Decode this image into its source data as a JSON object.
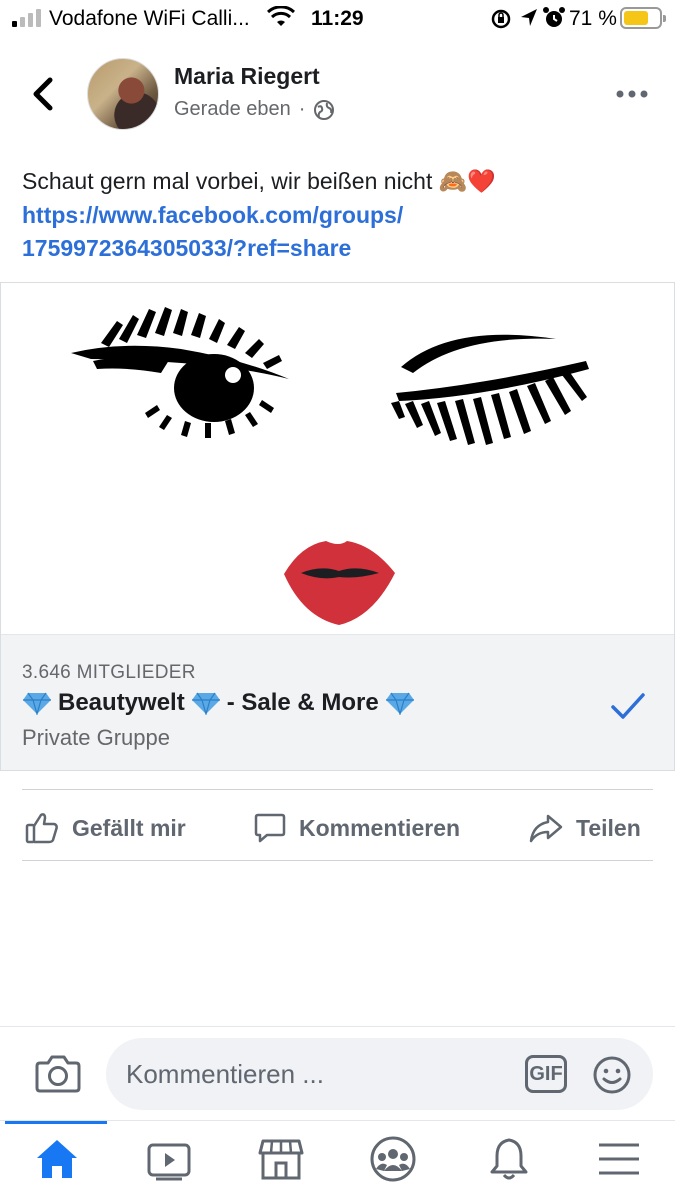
{
  "status_bar": {
    "carrier": "Vodafone WiFi Calli...",
    "time": "11:29",
    "battery_percent": "71 %",
    "battery_level": 0.71,
    "icons": [
      "signal-icon",
      "wifi-icon",
      "orientation-lock-icon",
      "location-arrow-icon",
      "alarm-icon",
      "battery-icon"
    ]
  },
  "header": {
    "author_name": "Maria Riegert",
    "timestamp": "Gerade eben",
    "separator": "·",
    "privacy_icon": "globe-icon"
  },
  "post": {
    "text": "Schaut gern mal vorbei, wir beißen nicht 🙈❤️",
    "link_line1": "https://www.facebook.com/groups/",
    "link_line2": "1759972364305033/?ref=share"
  },
  "shared_group": {
    "members": "3.646 MITGLIEDER",
    "name_part1": "Beautywelt",
    "name_part2": "- Sale & More",
    "privacy": "Private Gruppe",
    "joined_icon": "checkmark-icon"
  },
  "actions": {
    "like": "Gefällt mir",
    "comment": "Kommentieren",
    "share": "Teilen"
  },
  "comment_bar": {
    "placeholder": "Kommentieren ...",
    "gif_label": "GIF"
  },
  "tab_bar": {
    "tabs": [
      "home-icon",
      "watch-icon",
      "marketplace-icon",
      "groups-icon",
      "notifications-icon",
      "menu-icon"
    ],
    "active": "home-icon"
  },
  "colors": {
    "accent": "#1877f2",
    "link": "#2d6fd8",
    "muted": "#65676b",
    "lips": "#d0313a",
    "battery": "#f5c518"
  }
}
